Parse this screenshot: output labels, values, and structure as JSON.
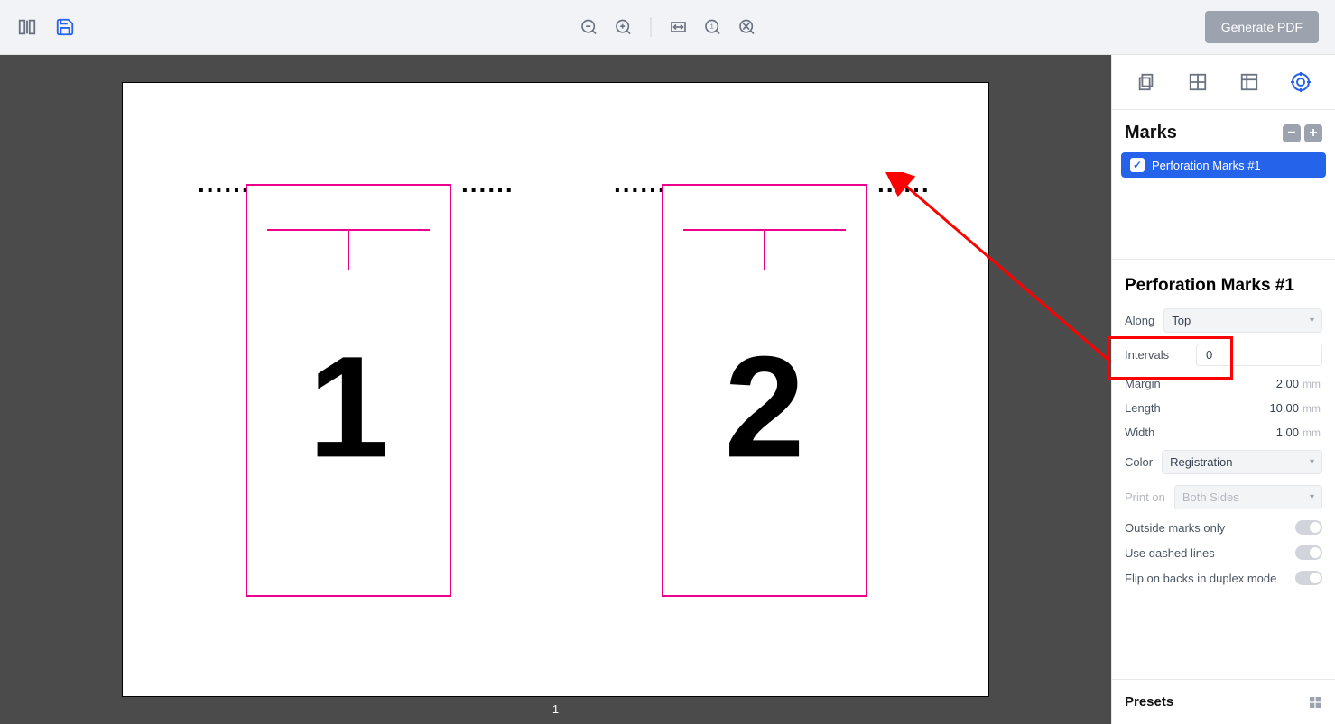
{
  "toolbar": {
    "generate_pdf_label": "Generate PDF"
  },
  "canvas": {
    "page_number": "1",
    "artboards": [
      {
        "number": "1"
      },
      {
        "number": "2"
      }
    ],
    "perforation_glyph": "......"
  },
  "sidebar": {
    "panel_title": "Marks",
    "marks": [
      {
        "label": "Perforation Marks #1",
        "checked": true
      }
    ],
    "properties_title": "Perforation Marks #1",
    "along": {
      "label": "Along",
      "value": "Top"
    },
    "intervals": {
      "label": "Intervals",
      "value": "0"
    },
    "margin": {
      "label": "Margin",
      "value": "2.00",
      "unit": "mm"
    },
    "length": {
      "label": "Length",
      "value": "10.00",
      "unit": "mm"
    },
    "width_prop": {
      "label": "Width",
      "value": "1.00",
      "unit": "mm"
    },
    "color": {
      "label": "Color",
      "value": "Registration"
    },
    "print_on": {
      "label": "Print on",
      "value": "Both Sides"
    },
    "toggles": {
      "outside": "Outside marks only",
      "dashed": "Use dashed lines",
      "flip": "Flip on backs in duplex mode"
    },
    "presets_label": "Presets"
  }
}
